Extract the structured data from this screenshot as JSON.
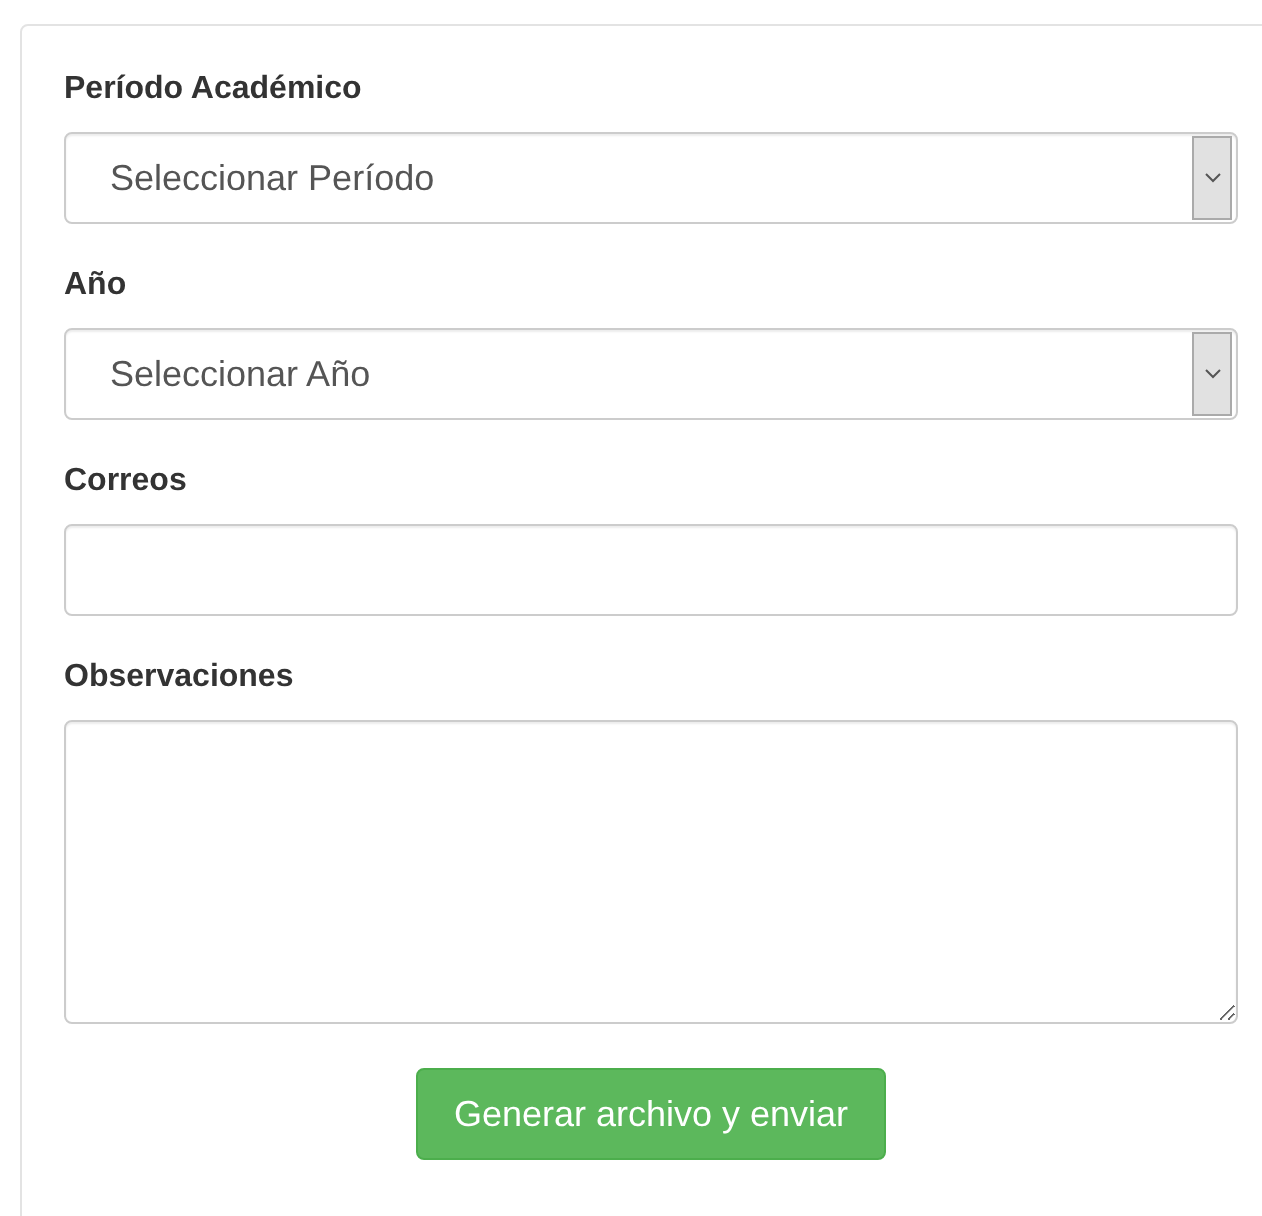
{
  "fields": [
    {
      "kind": "select",
      "label": "Período Académico",
      "value": "Seleccionar Período"
    },
    {
      "kind": "select",
      "label": "Año",
      "value": "Seleccionar Año"
    },
    {
      "kind": "input",
      "label": "Correos"
    },
    {
      "kind": "textarea",
      "label": "Observaciones"
    }
  ],
  "submit_button": "Generar archivo y enviar"
}
